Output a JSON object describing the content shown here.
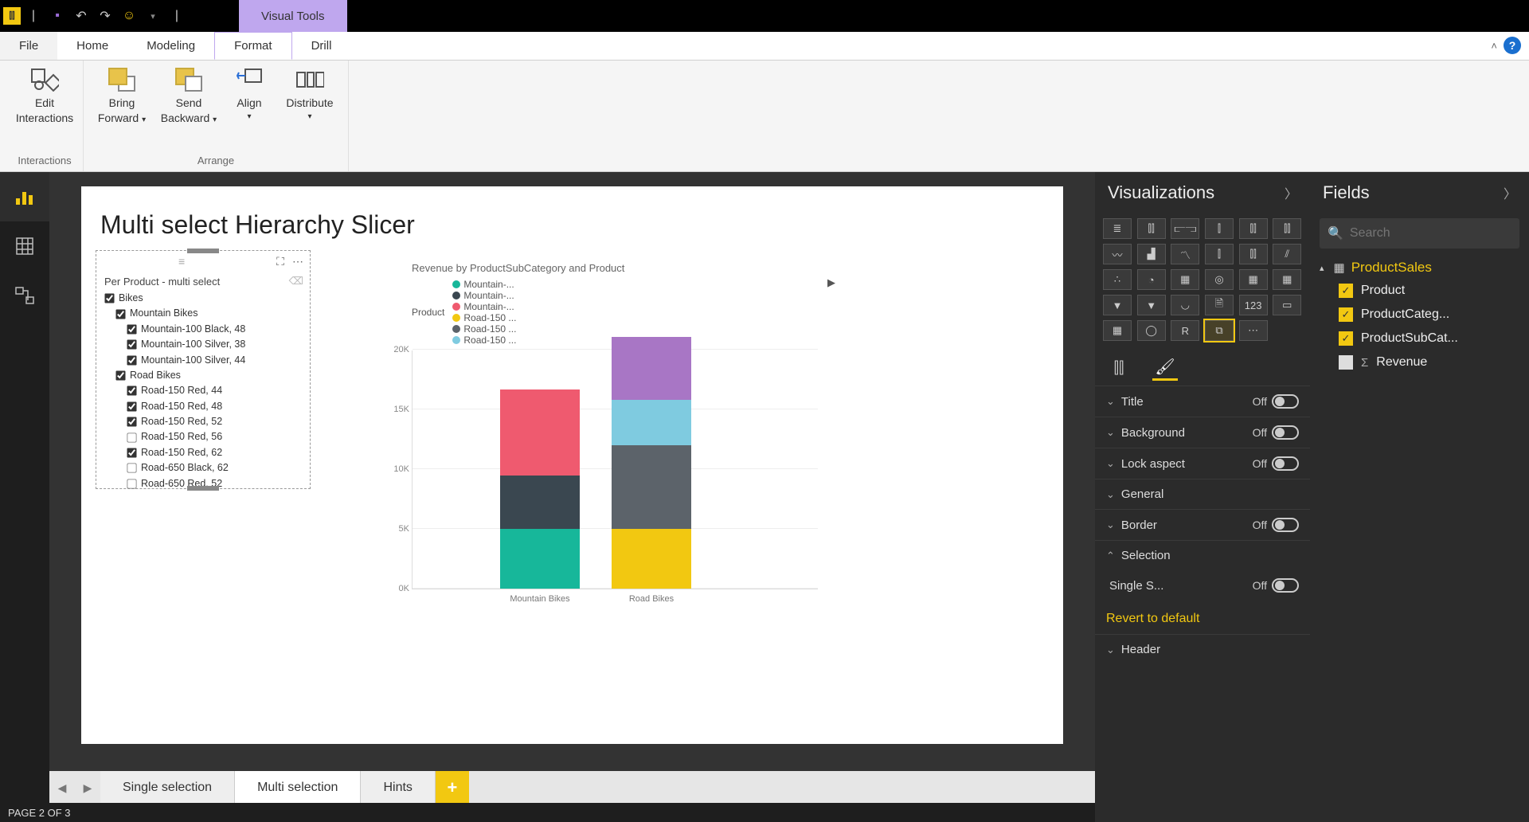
{
  "titlebar": {
    "visual_tools": "Visual Tools"
  },
  "ribbon_tabs": {
    "file": "File",
    "home": "Home",
    "modeling": "Modeling",
    "format": "Format",
    "drill": "Drill"
  },
  "ribbon": {
    "edit_interactions_l1": "Edit",
    "edit_interactions_l2": "Interactions",
    "bring_forward_l1": "Bring",
    "bring_forward_l2": "Forward",
    "send_backward_l1": "Send",
    "send_backward_l2": "Backward",
    "align": "Align",
    "distribute": "Distribute",
    "group_interactions": "Interactions",
    "group_arrange": "Arrange"
  },
  "report": {
    "title": "Multi select Hierarchy Slicer"
  },
  "slicer": {
    "header": "Per Product - multi select",
    "tree": [
      {
        "label": "Bikes",
        "checked": true,
        "level": 0
      },
      {
        "label": "Mountain Bikes",
        "checked": true,
        "level": 1
      },
      {
        "label": "Mountain-100 Black, 48",
        "checked": true,
        "level": 2
      },
      {
        "label": "Mountain-100 Silver, 38",
        "checked": true,
        "level": 2
      },
      {
        "label": "Mountain-100 Silver, 44",
        "checked": true,
        "level": 2
      },
      {
        "label": "Road Bikes",
        "checked": true,
        "level": 1
      },
      {
        "label": "Road-150 Red, 44",
        "checked": true,
        "level": 2
      },
      {
        "label": "Road-150 Red, 48",
        "checked": true,
        "level": 2
      },
      {
        "label": "Road-150 Red, 52",
        "checked": true,
        "level": 2
      },
      {
        "label": "Road-150 Red, 56",
        "checked": false,
        "level": 2
      },
      {
        "label": "Road-150 Red, 62",
        "checked": true,
        "level": 2
      },
      {
        "label": "Road-650 Black, 62",
        "checked": false,
        "level": 2
      },
      {
        "label": "Road-650 Red, 52",
        "checked": false,
        "level": 2
      }
    ]
  },
  "chart": {
    "title": "Revenue by ProductSubCategory and Product",
    "legend_key": "Product",
    "legend": [
      {
        "label": "Mountain-...",
        "color": "#17b79a"
      },
      {
        "label": "Mountain-...",
        "color": "#3a4750"
      },
      {
        "label": "Mountain-...",
        "color": "#ef5a6f"
      },
      {
        "label": "Road-150 ...",
        "color": "#f2c811"
      },
      {
        "label": "Road-150 ...",
        "color": "#5c636a"
      },
      {
        "label": "Road-150 ...",
        "color": "#7fcbe0"
      }
    ],
    "yticks": [
      "20K",
      "15K",
      "10K",
      "5K",
      "0K"
    ]
  },
  "chart_data": {
    "type": "bar",
    "stacked": true,
    "title": "Revenue by ProductSubCategory and Product",
    "xlabel": "",
    "ylabel": "",
    "ylim": [
      0,
      20000
    ],
    "categories": [
      "Mountain Bikes",
      "Road Bikes"
    ],
    "series": [
      {
        "name": "Mountain-100 Black, 48",
        "color": "#17b79a",
        "values": [
          5000,
          0
        ]
      },
      {
        "name": "Mountain-100 Silver, 38",
        "color": "#3a4750",
        "values": [
          4500,
          0
        ]
      },
      {
        "name": "Mountain-100 Silver, 44",
        "color": "#ef5a6f",
        "values": [
          7200,
          0
        ]
      },
      {
        "name": "Road-150 Red, 44",
        "color": "#f2c811",
        "values": [
          0,
          5000
        ]
      },
      {
        "name": "Road-150 Red, 48",
        "color": "#5c636a",
        "values": [
          0,
          7000
        ]
      },
      {
        "name": "Road-150 Red, 52",
        "color": "#7fcbe0",
        "values": [
          0,
          3800
        ]
      },
      {
        "name": "Road-150 Red, 62",
        "color": "#a876c5",
        "values": [
          0,
          5300
        ]
      }
    ]
  },
  "pages": {
    "p1": "Single selection",
    "p2": "Multi selection",
    "p3": "Hints"
  },
  "status": {
    "page": "PAGE 2 OF 3"
  },
  "viz_pane": {
    "title": "Visualizations"
  },
  "format_items": {
    "title": "Title",
    "background": "Background",
    "lock": "Lock aspect",
    "general": "General",
    "border": "Border",
    "selection": "Selection",
    "single_select": "Single S...",
    "header": "Header",
    "off": "Off",
    "revert": "Revert to default"
  },
  "fields_pane": {
    "title": "Fields",
    "search_placeholder": "Search",
    "table": "ProductSales",
    "f1": "Product",
    "f2": "ProductCateg...",
    "f3": "ProductSubCat...",
    "f4": "Revenue"
  }
}
